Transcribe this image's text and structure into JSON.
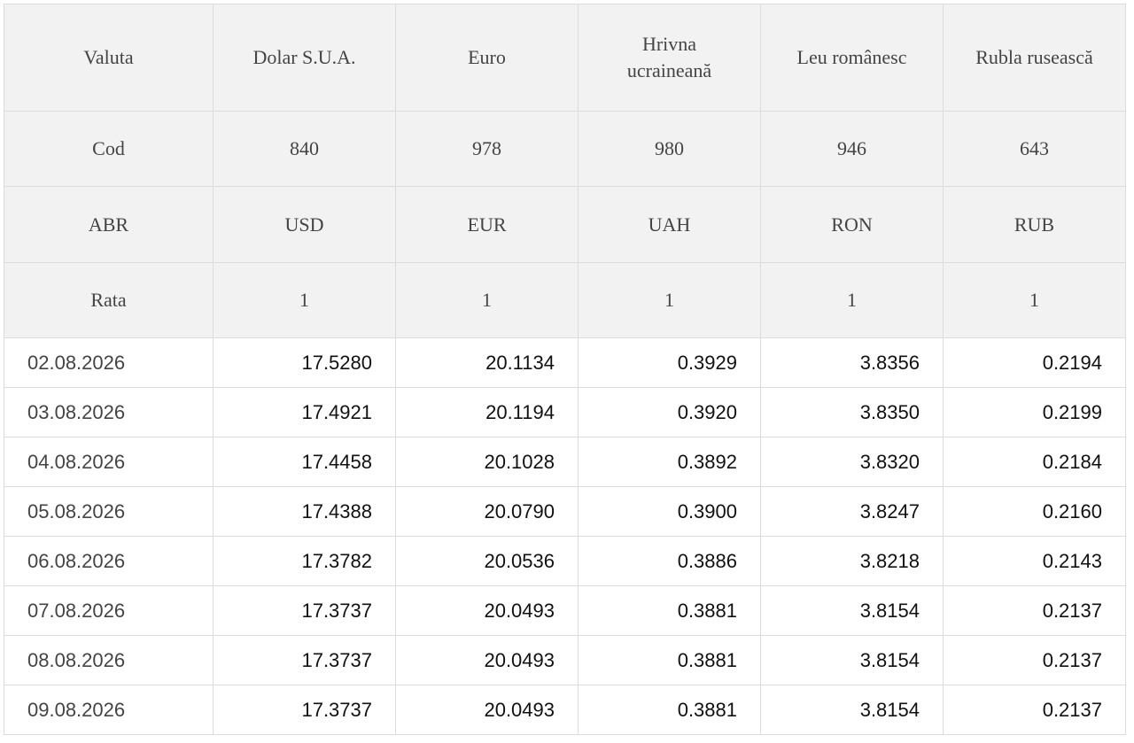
{
  "table": {
    "header_rows": [
      {
        "key": "name",
        "label": "Valuta",
        "values": [
          "Dolar S.U.A.",
          "Euro",
          "Hrivna ucraineană",
          "Leu românesc",
          "Rubla rusească"
        ]
      },
      {
        "key": "code",
        "label": "Cod",
        "values": [
          "840",
          "978",
          "980",
          "946",
          "643"
        ]
      },
      {
        "key": "abr",
        "label": "ABR",
        "values": [
          "USD",
          "EUR",
          "UAH",
          "RON",
          "RUB"
        ]
      },
      {
        "key": "rate",
        "label": "Rata",
        "values": [
          "1",
          "1",
          "1",
          "1",
          "1"
        ]
      }
    ],
    "rows": [
      {
        "date": "02.08.2026",
        "values": [
          "17.5280",
          "20.1134",
          "0.3929",
          "3.8356",
          "0.2194"
        ]
      },
      {
        "date": "03.08.2026",
        "values": [
          "17.4921",
          "20.1194",
          "0.3920",
          "3.8350",
          "0.2199"
        ]
      },
      {
        "date": "04.08.2026",
        "values": [
          "17.4458",
          "20.1028",
          "0.3892",
          "3.8320",
          "0.2184"
        ]
      },
      {
        "date": "05.08.2026",
        "values": [
          "17.4388",
          "20.0790",
          "0.3900",
          "3.8247",
          "0.2160"
        ]
      },
      {
        "date": "06.08.2026",
        "values": [
          "17.3782",
          "20.0536",
          "0.3886",
          "3.8218",
          "0.2143"
        ]
      },
      {
        "date": "07.08.2026",
        "values": [
          "17.3737",
          "20.0493",
          "0.3881",
          "3.8154",
          "0.2137"
        ]
      },
      {
        "date": "08.08.2026",
        "values": [
          "17.3737",
          "20.0493",
          "0.3881",
          "3.8154",
          "0.2137"
        ]
      },
      {
        "date": "09.08.2026",
        "values": [
          "17.3737",
          "20.0493",
          "0.3881",
          "3.8154",
          "0.2137"
        ]
      }
    ]
  }
}
